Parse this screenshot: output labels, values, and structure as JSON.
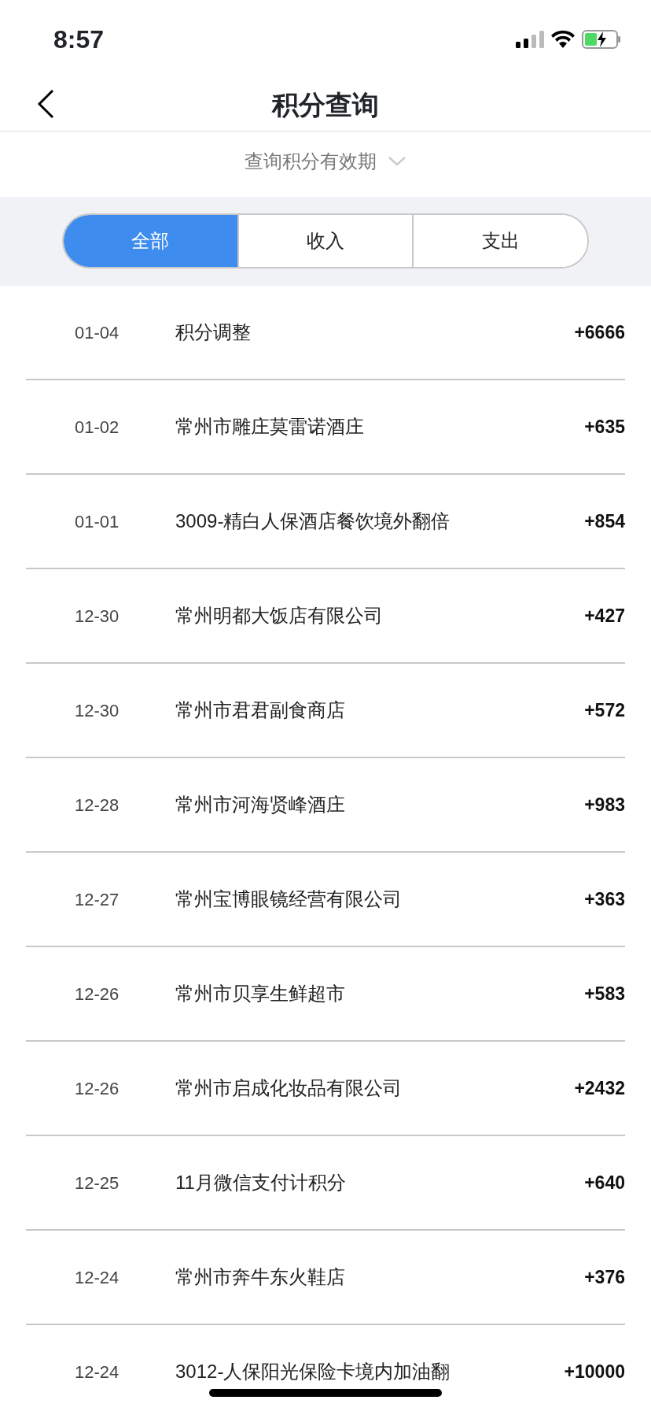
{
  "status_bar": {
    "time": "8:57"
  },
  "nav": {
    "title": "积分查询"
  },
  "summary": {
    "validity_link": "查询积分有效期"
  },
  "tabs": [
    {
      "label": "全部",
      "selected": true
    },
    {
      "label": "收入",
      "selected": false
    },
    {
      "label": "支出",
      "selected": false
    }
  ],
  "records": [
    {
      "date": "01-04",
      "name": "积分调整",
      "points": "+6666"
    },
    {
      "date": "01-02",
      "name": "常州市雕庄莫雷诺酒庄",
      "points": "+635"
    },
    {
      "date": "01-01",
      "name": "3009-精白人保酒店餐饮境外翻倍",
      "points": "+854"
    },
    {
      "date": "12-30",
      "name": "常州明都大饭店有限公司",
      "points": "+427"
    },
    {
      "date": "12-30",
      "name": "常州市君君副食商店",
      "points": "+572"
    },
    {
      "date": "12-28",
      "name": "常州市河海贤峰酒庄",
      "points": "+983"
    },
    {
      "date": "12-27",
      "name": "常州宝博眼镜经营有限公司",
      "points": "+363"
    },
    {
      "date": "12-26",
      "name": "常州市贝享生鲜超市",
      "points": "+583"
    },
    {
      "date": "12-26",
      "name": "常州市启成化妆品有限公司",
      "points": "+2432"
    },
    {
      "date": "12-25",
      "name": "11月微信支付计积分",
      "points": "+640"
    },
    {
      "date": "12-24",
      "name": "常州市奔牛东火鞋店",
      "points": "+376"
    },
    {
      "date": "12-24",
      "name": "3012-人保阳光保险卡境内加油翻",
      "points": "+10000"
    }
  ]
}
